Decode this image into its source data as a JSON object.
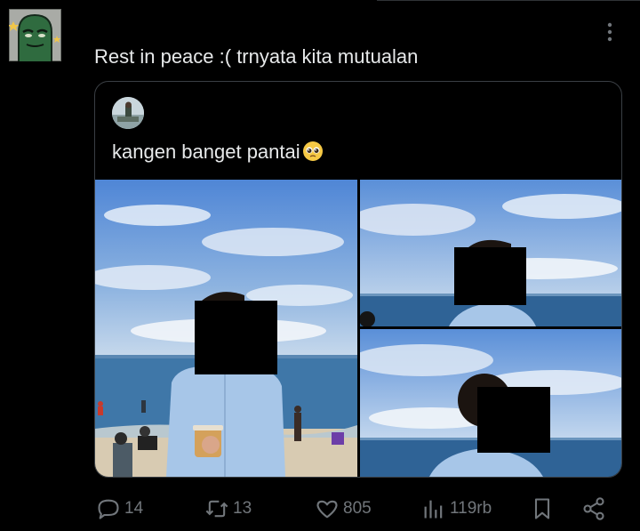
{
  "tweet": {
    "text": "Rest in peace :( trnyata kita mutualan",
    "avatar_icon": "green-cartoon-avatar",
    "more_icon": "more-vertical-icon"
  },
  "quoted": {
    "text": "kangen banget pantai",
    "emoji": "pleading-face-emoji",
    "avatar_icon": "beach-photo-avatar",
    "photos": [
      "beach-photo-standing-man",
      "beach-photo-shoulders",
      "beach-photo-head"
    ]
  },
  "actions": {
    "reply": {
      "icon": "reply-icon",
      "count": "14"
    },
    "repost": {
      "icon": "repost-icon",
      "count": "13"
    },
    "like": {
      "icon": "heart-icon",
      "count": "805"
    },
    "views": {
      "icon": "views-icon",
      "count": "119rb"
    },
    "bookmark": {
      "icon": "bookmark-icon"
    },
    "share": {
      "icon": "share-icon"
    }
  },
  "colors": {
    "background": "#000000",
    "text": "#e7e9ea",
    "muted": "#71767b",
    "border": "#3a3f44",
    "sky": "#6f9fd4",
    "sea": "#3f77a8",
    "sand": "#d8cbb2",
    "shirt": "#a7c6e8"
  }
}
